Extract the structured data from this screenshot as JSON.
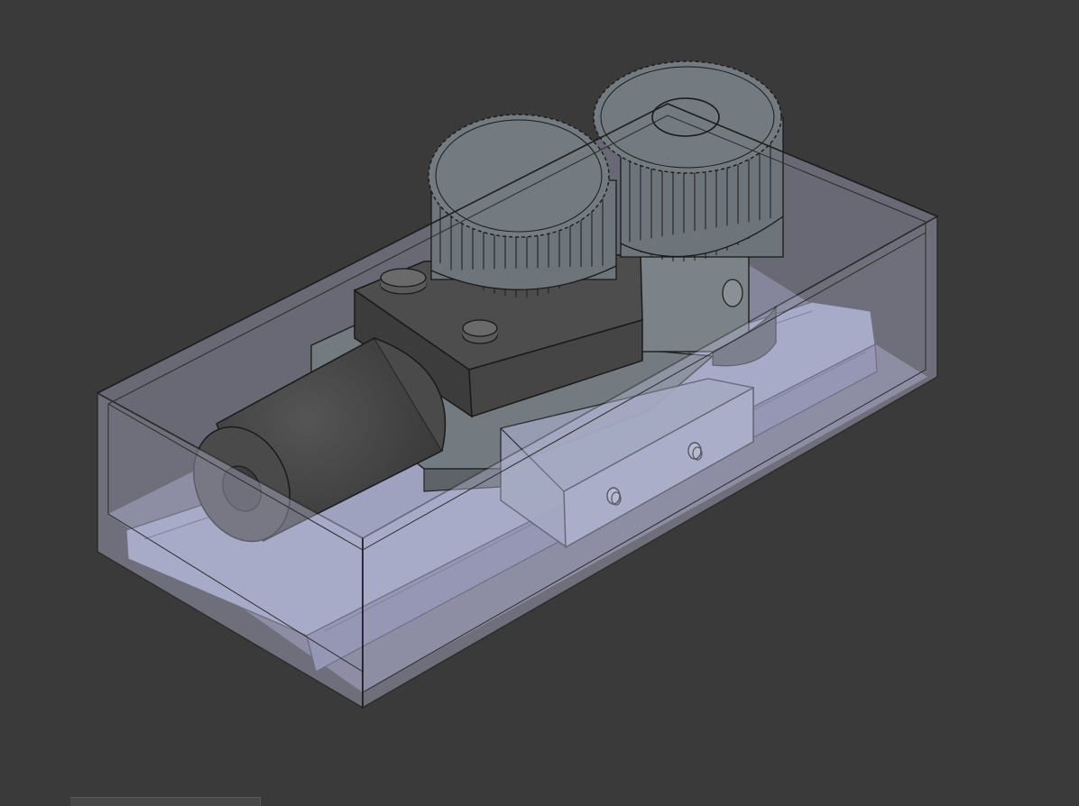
{
  "viewport": {
    "background": "#3a3a3a",
    "object": "transparent-enclosure-with-gear-assembly",
    "colors": {
      "enclosure": "#b6b8d4",
      "gear": "#6f777d",
      "motor": "#444444",
      "block": "#7b8084",
      "edge": "#1e1e1e"
    }
  }
}
